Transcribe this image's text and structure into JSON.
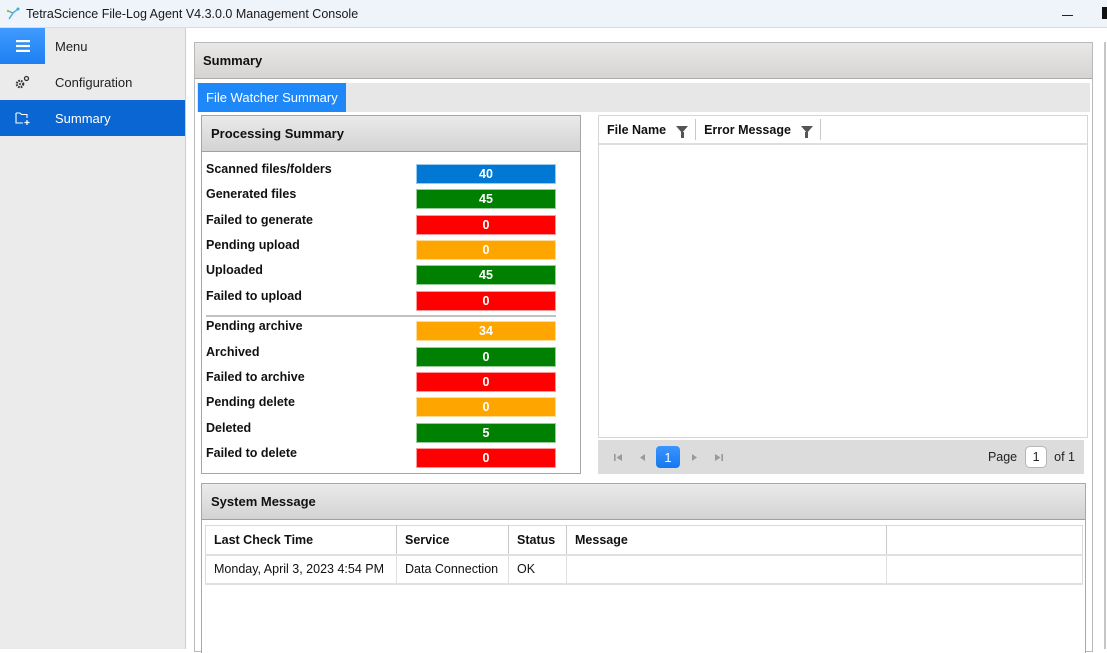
{
  "window": {
    "title": "TetraScience File-Log Agent V4.3.0.0 Management Console",
    "app_icon": "tetrascience-logo-icon"
  },
  "sidebar": {
    "items": [
      {
        "label": "Menu",
        "icon": "hamburger-menu-icon"
      },
      {
        "label": "Configuration",
        "icon": "gears-icon"
      },
      {
        "label": "Summary",
        "icon": "folder-add-icon",
        "selected": true
      }
    ]
  },
  "panel": {
    "title": "Summary",
    "tabs": [
      {
        "label": "File Watcher Summary",
        "active": true
      }
    ]
  },
  "processing_summary": {
    "title": "Processing Summary",
    "colors": {
      "blue": "#0078d4",
      "green": "#008000",
      "red": "#ff0000",
      "orange": "#ffa500"
    },
    "stats": [
      {
        "label": "Scanned files/folders",
        "value": "40",
        "color": "#0078d4"
      },
      {
        "label": "Generated files",
        "value": "45",
        "color": "#008000"
      },
      {
        "label": "Failed to generate",
        "value": "0",
        "color": "#ff0000"
      },
      {
        "label": "Pending upload",
        "value": "0",
        "color": "#ffa500"
      },
      {
        "label": "Uploaded",
        "value": "45",
        "color": "#008000"
      },
      {
        "label": "Failed to upload",
        "value": "0",
        "color": "#ff0000"
      },
      {
        "label": "Pending archive",
        "value": "34",
        "color": "#ffa500"
      },
      {
        "label": "Archived",
        "value": "0",
        "color": "#008000"
      },
      {
        "label": "Failed to archive",
        "value": "0",
        "color": "#ff0000"
      },
      {
        "label": "Pending delete",
        "value": "0",
        "color": "#ffa500"
      },
      {
        "label": "Deleted",
        "value": "5",
        "color": "#008000"
      },
      {
        "label": "Failed to delete",
        "value": "0",
        "color": "#ff0000"
      }
    ]
  },
  "error_grid": {
    "columns": [
      {
        "label": "File Name",
        "icon": "filter-icon"
      },
      {
        "label": "Error Message",
        "icon": "filter-icon"
      }
    ],
    "rows": [],
    "pager": {
      "current_page": "1",
      "page_label": "Page",
      "page_input": "1",
      "of_label": "of 1"
    }
  },
  "system_message": {
    "title": "System Message",
    "columns": [
      "Last Check Time",
      "Service",
      "Status",
      "Message",
      ""
    ],
    "rows": [
      [
        "Monday, April 3, 2023 4:54 PM",
        "Data Connection",
        "OK",
        "",
        ""
      ]
    ]
  }
}
